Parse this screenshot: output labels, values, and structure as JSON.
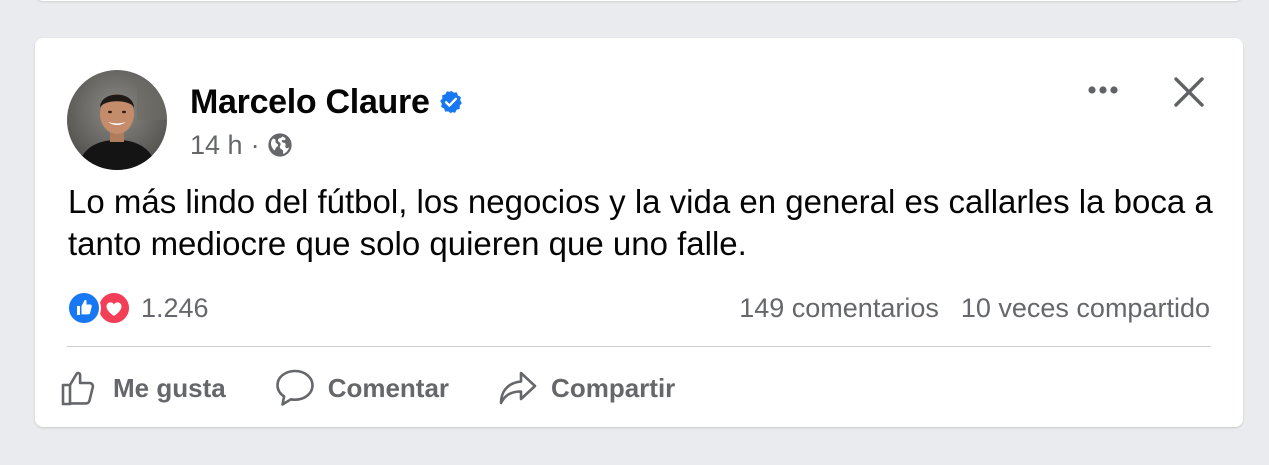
{
  "post": {
    "author": {
      "name": "Marcelo Claure",
      "verified": true
    },
    "meta": {
      "time": "14 h",
      "separator": "·",
      "audience_icon": "globe-icon"
    },
    "text": "Lo más lindo del fútbol, los negocios y la vida en general es callarles la boca a tanto mediocre que solo quieren que uno falle.",
    "reactions": {
      "icons": [
        "like-reaction-icon",
        "love-reaction-icon"
      ],
      "count": "1.246"
    },
    "stats": {
      "comments": "149 comentarios",
      "shares": "10 veces compartido"
    },
    "actions": {
      "like": "Me gusta",
      "comment": "Comentar",
      "share": "Compartir"
    },
    "header_controls": {
      "more_icon": "more-options-icon",
      "close_icon": "close-icon"
    }
  },
  "colors": {
    "background": "#e9ebee",
    "card": "#ffffff",
    "primary_text": "#050505",
    "secondary_text": "#65676b",
    "verified_blue": "#1877f2",
    "like_blue": "#1877f2",
    "love_red": "#f33e58",
    "divider": "#ced0d4"
  }
}
